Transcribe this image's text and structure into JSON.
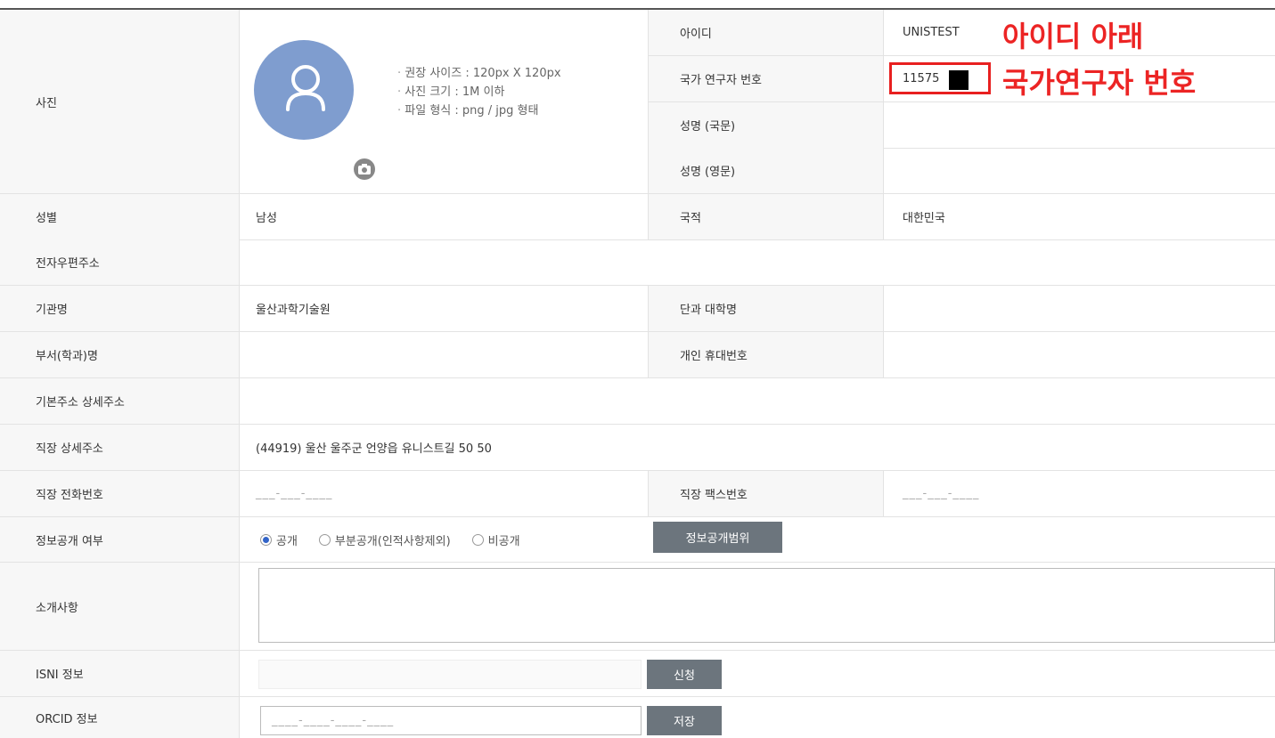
{
  "labels": {
    "photo": "사진",
    "id": "아이디",
    "researcher_no": "국가 연구자 번호",
    "name_kr": "성명 (국문)",
    "name_en": "성명 (영문)",
    "gender": "성별",
    "nationality": "국적",
    "email": "전자우편주소",
    "institution": "기관명",
    "college": "단과 대학명",
    "department": "부서(학과)명",
    "mobile": "개인 휴대번호",
    "address": "기본주소 상세주소",
    "work_address": "직장 상세주소",
    "work_phone": "직장 전화번호",
    "work_fax": "직장 팩스번호",
    "disclosure": "정보공개 여부",
    "intro": "소개사항",
    "isni": "ISNI 정보",
    "orcid": "ORCID 정보"
  },
  "photo_notes": [
    "권장 사이즈 : 120px X 120px",
    "사진 크기 : 1M 이하",
    "파일 형식 : png / jpg 형태"
  ],
  "values": {
    "id": "UNISTEST",
    "researcher_no": "11575",
    "gender": "남성",
    "nationality": "대한민국",
    "institution": "울산과학기술원",
    "work_address": "(44919) 울산 울주군 언양읍 유니스트길 50 50",
    "work_phone": "___-___-____",
    "work_fax": "___-___-____",
    "orcid_placeholder": "____-____-____-____"
  },
  "disclosure_options": [
    {
      "label": "공개",
      "selected": true
    },
    {
      "label": "부분공개(인적사항제외)",
      "selected": false
    },
    {
      "label": "비공개",
      "selected": false
    }
  ],
  "buttons": {
    "scope": "정보공개범위",
    "apply": "신청",
    "save": "저장"
  },
  "annotation": {
    "line1": "아이디 아래",
    "line2": "국가연구자 번호"
  },
  "colors": {
    "annotation": "#ec2424",
    "avatar": "#7f9dcf",
    "button": "#6c757d",
    "radio_selected": "#3264c8"
  }
}
